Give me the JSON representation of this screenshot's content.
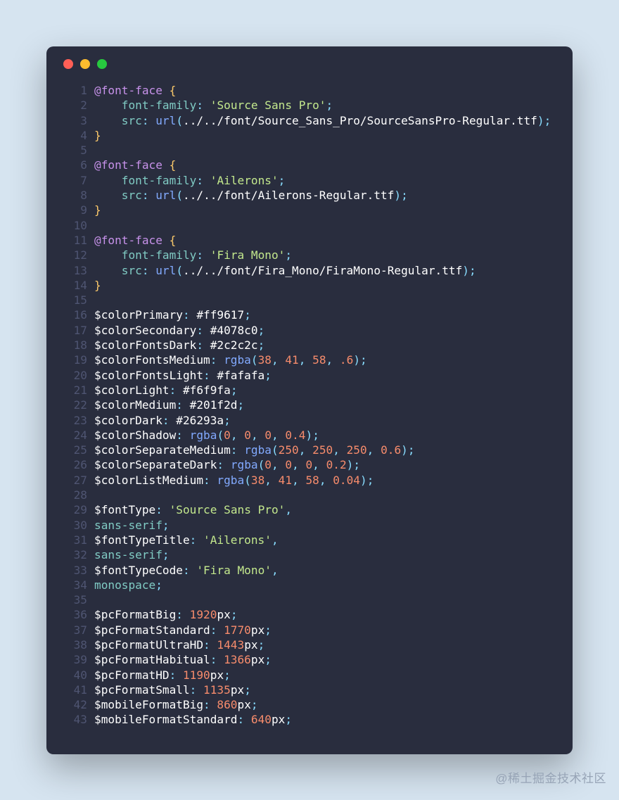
{
  "watermark": "@稀土掘金技术社区",
  "lines": [
    [
      {
        "t": "@font-face",
        "c": "tok-at"
      },
      {
        "t": " ",
        "c": ""
      },
      {
        "t": "{",
        "c": "tok-brace"
      }
    ],
    [
      {
        "t": "    ",
        "c": ""
      },
      {
        "t": "font-family",
        "c": "tok-prop"
      },
      {
        "t": ": ",
        "c": "tok-punc"
      },
      {
        "t": "'Source Sans Pro'",
        "c": "tok-str"
      },
      {
        "t": ";",
        "c": "tok-punc"
      }
    ],
    [
      {
        "t": "    ",
        "c": ""
      },
      {
        "t": "src",
        "c": "tok-prop"
      },
      {
        "t": ": ",
        "c": "tok-punc"
      },
      {
        "t": "url",
        "c": "tok-func"
      },
      {
        "t": "(",
        "c": "tok-punc"
      },
      {
        "t": "../../font/Source_Sans_Pro/SourceSansPro-Regular.ttf",
        "c": "tok-white"
      },
      {
        "t": ")",
        "c": "tok-punc"
      },
      {
        "t": ";",
        "c": "tok-punc"
      }
    ],
    [
      {
        "t": "}",
        "c": "tok-brace"
      }
    ],
    [
      {
        "t": "",
        "c": ""
      }
    ],
    [
      {
        "t": "@font-face",
        "c": "tok-at"
      },
      {
        "t": " ",
        "c": ""
      },
      {
        "t": "{",
        "c": "tok-brace"
      }
    ],
    [
      {
        "t": "    ",
        "c": ""
      },
      {
        "t": "font-family",
        "c": "tok-prop"
      },
      {
        "t": ": ",
        "c": "tok-punc"
      },
      {
        "t": "'Ailerons'",
        "c": "tok-str"
      },
      {
        "t": ";",
        "c": "tok-punc"
      }
    ],
    [
      {
        "t": "    ",
        "c": ""
      },
      {
        "t": "src",
        "c": "tok-prop"
      },
      {
        "t": ": ",
        "c": "tok-punc"
      },
      {
        "t": "url",
        "c": "tok-func"
      },
      {
        "t": "(",
        "c": "tok-punc"
      },
      {
        "t": "../../font/Ailerons-Regular.ttf",
        "c": "tok-white"
      },
      {
        "t": ")",
        "c": "tok-punc"
      },
      {
        "t": ";",
        "c": "tok-punc"
      }
    ],
    [
      {
        "t": "}",
        "c": "tok-brace"
      }
    ],
    [
      {
        "t": "",
        "c": ""
      }
    ],
    [
      {
        "t": "@font-face",
        "c": "tok-at"
      },
      {
        "t": " ",
        "c": ""
      },
      {
        "t": "{",
        "c": "tok-brace"
      }
    ],
    [
      {
        "t": "    ",
        "c": ""
      },
      {
        "t": "font-family",
        "c": "tok-prop"
      },
      {
        "t": ": ",
        "c": "tok-punc"
      },
      {
        "t": "'Fira Mono'",
        "c": "tok-str"
      },
      {
        "t": ";",
        "c": "tok-punc"
      }
    ],
    [
      {
        "t": "    ",
        "c": ""
      },
      {
        "t": "src",
        "c": "tok-prop"
      },
      {
        "t": ": ",
        "c": "tok-punc"
      },
      {
        "t": "url",
        "c": "tok-func"
      },
      {
        "t": "(",
        "c": "tok-punc"
      },
      {
        "t": "../../font/Fira_Mono/FiraMono-Regular.ttf",
        "c": "tok-white"
      },
      {
        "t": ")",
        "c": "tok-punc"
      },
      {
        "t": ";",
        "c": "tok-punc"
      }
    ],
    [
      {
        "t": "}",
        "c": "tok-brace"
      }
    ],
    [
      {
        "t": "",
        "c": ""
      }
    ],
    [
      {
        "t": "$colorPrimary",
        "c": "tok-white"
      },
      {
        "t": ": ",
        "c": "tok-punc"
      },
      {
        "t": "#ff9617",
        "c": "tok-white"
      },
      {
        "t": ";",
        "c": "tok-punc"
      }
    ],
    [
      {
        "t": "$colorSecondary",
        "c": "tok-white"
      },
      {
        "t": ": ",
        "c": "tok-punc"
      },
      {
        "t": "#4078c0",
        "c": "tok-white"
      },
      {
        "t": ";",
        "c": "tok-punc"
      }
    ],
    [
      {
        "t": "$colorFontsDark",
        "c": "tok-white"
      },
      {
        "t": ": ",
        "c": "tok-punc"
      },
      {
        "t": "#2c2c2c",
        "c": "tok-white"
      },
      {
        "t": ";",
        "c": "tok-punc"
      }
    ],
    [
      {
        "t": "$colorFontsMedium",
        "c": "tok-white"
      },
      {
        "t": ": ",
        "c": "tok-punc"
      },
      {
        "t": "rgba",
        "c": "tok-func"
      },
      {
        "t": "(",
        "c": "tok-punc"
      },
      {
        "t": "38",
        "c": "tok-num"
      },
      {
        "t": ", ",
        "c": "tok-punc"
      },
      {
        "t": "41",
        "c": "tok-num"
      },
      {
        "t": ", ",
        "c": "tok-punc"
      },
      {
        "t": "58",
        "c": "tok-num"
      },
      {
        "t": ", ",
        "c": "tok-punc"
      },
      {
        "t": ".6",
        "c": "tok-num"
      },
      {
        "t": ")",
        "c": "tok-punc"
      },
      {
        "t": ";",
        "c": "tok-punc"
      }
    ],
    [
      {
        "t": "$colorFontsLight",
        "c": "tok-white"
      },
      {
        "t": ": ",
        "c": "tok-punc"
      },
      {
        "t": "#fafafa",
        "c": "tok-white"
      },
      {
        "t": ";",
        "c": "tok-punc"
      }
    ],
    [
      {
        "t": "$colorLight",
        "c": "tok-white"
      },
      {
        "t": ": ",
        "c": "tok-punc"
      },
      {
        "t": "#f6f9fa",
        "c": "tok-white"
      },
      {
        "t": ";",
        "c": "tok-punc"
      }
    ],
    [
      {
        "t": "$colorMedium",
        "c": "tok-white"
      },
      {
        "t": ": ",
        "c": "tok-punc"
      },
      {
        "t": "#201f2d",
        "c": "tok-white"
      },
      {
        "t": ";",
        "c": "tok-punc"
      }
    ],
    [
      {
        "t": "$colorDark",
        "c": "tok-white"
      },
      {
        "t": ": ",
        "c": "tok-punc"
      },
      {
        "t": "#26293a",
        "c": "tok-white"
      },
      {
        "t": ";",
        "c": "tok-punc"
      }
    ],
    [
      {
        "t": "$colorShadow",
        "c": "tok-white"
      },
      {
        "t": ": ",
        "c": "tok-punc"
      },
      {
        "t": "rgba",
        "c": "tok-func"
      },
      {
        "t": "(",
        "c": "tok-punc"
      },
      {
        "t": "0",
        "c": "tok-num"
      },
      {
        "t": ", ",
        "c": "tok-punc"
      },
      {
        "t": "0",
        "c": "tok-num"
      },
      {
        "t": ", ",
        "c": "tok-punc"
      },
      {
        "t": "0",
        "c": "tok-num"
      },
      {
        "t": ", ",
        "c": "tok-punc"
      },
      {
        "t": "0.4",
        "c": "tok-num"
      },
      {
        "t": ")",
        "c": "tok-punc"
      },
      {
        "t": ";",
        "c": "tok-punc"
      }
    ],
    [
      {
        "t": "$colorSeparateMedium",
        "c": "tok-white"
      },
      {
        "t": ": ",
        "c": "tok-punc"
      },
      {
        "t": "rgba",
        "c": "tok-func"
      },
      {
        "t": "(",
        "c": "tok-punc"
      },
      {
        "t": "250",
        "c": "tok-num"
      },
      {
        "t": ", ",
        "c": "tok-punc"
      },
      {
        "t": "250",
        "c": "tok-num"
      },
      {
        "t": ", ",
        "c": "tok-punc"
      },
      {
        "t": "250",
        "c": "tok-num"
      },
      {
        "t": ", ",
        "c": "tok-punc"
      },
      {
        "t": "0.6",
        "c": "tok-num"
      },
      {
        "t": ")",
        "c": "tok-punc"
      },
      {
        "t": ";",
        "c": "tok-punc"
      }
    ],
    [
      {
        "t": "$colorSeparateDark",
        "c": "tok-white"
      },
      {
        "t": ": ",
        "c": "tok-punc"
      },
      {
        "t": "rgba",
        "c": "tok-func"
      },
      {
        "t": "(",
        "c": "tok-punc"
      },
      {
        "t": "0",
        "c": "tok-num"
      },
      {
        "t": ", ",
        "c": "tok-punc"
      },
      {
        "t": "0",
        "c": "tok-num"
      },
      {
        "t": ", ",
        "c": "tok-punc"
      },
      {
        "t": "0",
        "c": "tok-num"
      },
      {
        "t": ", ",
        "c": "tok-punc"
      },
      {
        "t": "0.2",
        "c": "tok-num"
      },
      {
        "t": ")",
        "c": "tok-punc"
      },
      {
        "t": ";",
        "c": "tok-punc"
      }
    ],
    [
      {
        "t": "$colorListMedium",
        "c": "tok-white"
      },
      {
        "t": ": ",
        "c": "tok-punc"
      },
      {
        "t": "rgba",
        "c": "tok-func"
      },
      {
        "t": "(",
        "c": "tok-punc"
      },
      {
        "t": "38",
        "c": "tok-num"
      },
      {
        "t": ", ",
        "c": "tok-punc"
      },
      {
        "t": "41",
        "c": "tok-num"
      },
      {
        "t": ", ",
        "c": "tok-punc"
      },
      {
        "t": "58",
        "c": "tok-num"
      },
      {
        "t": ", ",
        "c": "tok-punc"
      },
      {
        "t": "0.04",
        "c": "tok-num"
      },
      {
        "t": ")",
        "c": "tok-punc"
      },
      {
        "t": ";",
        "c": "tok-punc"
      }
    ],
    [
      {
        "t": "",
        "c": ""
      }
    ],
    [
      {
        "t": "$fontType",
        "c": "tok-white"
      },
      {
        "t": ": ",
        "c": "tok-punc"
      },
      {
        "t": "'Source Sans Pro'",
        "c": "tok-str"
      },
      {
        "t": ",",
        "c": "tok-punc"
      }
    ],
    [
      {
        "t": "sans-serif",
        "c": "tok-prop"
      },
      {
        "t": ";",
        "c": "tok-punc"
      }
    ],
    [
      {
        "t": "$fontTypeTitle",
        "c": "tok-white"
      },
      {
        "t": ": ",
        "c": "tok-punc"
      },
      {
        "t": "'Ailerons'",
        "c": "tok-str"
      },
      {
        "t": ",",
        "c": "tok-punc"
      }
    ],
    [
      {
        "t": "sans-serif",
        "c": "tok-prop"
      },
      {
        "t": ";",
        "c": "tok-punc"
      }
    ],
    [
      {
        "t": "$fontTypeCode",
        "c": "tok-white"
      },
      {
        "t": ": ",
        "c": "tok-punc"
      },
      {
        "t": "'Fira Mono'",
        "c": "tok-str"
      },
      {
        "t": ",",
        "c": "tok-punc"
      }
    ],
    [
      {
        "t": "monospace",
        "c": "tok-prop"
      },
      {
        "t": ";",
        "c": "tok-punc"
      }
    ],
    [
      {
        "t": "",
        "c": ""
      }
    ],
    [
      {
        "t": "$pcFormatBig",
        "c": "tok-white"
      },
      {
        "t": ": ",
        "c": "tok-punc"
      },
      {
        "t": "1920",
        "c": "tok-num"
      },
      {
        "t": "px",
        "c": "tok-white"
      },
      {
        "t": ";",
        "c": "tok-punc"
      }
    ],
    [
      {
        "t": "$pcFormatStandard",
        "c": "tok-white"
      },
      {
        "t": ": ",
        "c": "tok-punc"
      },
      {
        "t": "1770",
        "c": "tok-num"
      },
      {
        "t": "px",
        "c": "tok-white"
      },
      {
        "t": ";",
        "c": "tok-punc"
      }
    ],
    [
      {
        "t": "$pcFormatUltraHD",
        "c": "tok-white"
      },
      {
        "t": ": ",
        "c": "tok-punc"
      },
      {
        "t": "1443",
        "c": "tok-num"
      },
      {
        "t": "px",
        "c": "tok-white"
      },
      {
        "t": ";",
        "c": "tok-punc"
      }
    ],
    [
      {
        "t": "$pcFormatHabitual",
        "c": "tok-white"
      },
      {
        "t": ": ",
        "c": "tok-punc"
      },
      {
        "t": "1366",
        "c": "tok-num"
      },
      {
        "t": "px",
        "c": "tok-white"
      },
      {
        "t": ";",
        "c": "tok-punc"
      }
    ],
    [
      {
        "t": "$pcFormatHD",
        "c": "tok-white"
      },
      {
        "t": ": ",
        "c": "tok-punc"
      },
      {
        "t": "1190",
        "c": "tok-num"
      },
      {
        "t": "px",
        "c": "tok-white"
      },
      {
        "t": ";",
        "c": "tok-punc"
      }
    ],
    [
      {
        "t": "$pcFormatSmall",
        "c": "tok-white"
      },
      {
        "t": ": ",
        "c": "tok-punc"
      },
      {
        "t": "1135",
        "c": "tok-num"
      },
      {
        "t": "px",
        "c": "tok-white"
      },
      {
        "t": ";",
        "c": "tok-punc"
      }
    ],
    [
      {
        "t": "$mobileFormatBig",
        "c": "tok-white"
      },
      {
        "t": ": ",
        "c": "tok-punc"
      },
      {
        "t": "860",
        "c": "tok-num"
      },
      {
        "t": "px",
        "c": "tok-white"
      },
      {
        "t": ";",
        "c": "tok-punc"
      }
    ],
    [
      {
        "t": "$mobileFormatStandard",
        "c": "tok-white"
      },
      {
        "t": ": ",
        "c": "tok-punc"
      },
      {
        "t": "640",
        "c": "tok-num"
      },
      {
        "t": "px",
        "c": "tok-white"
      },
      {
        "t": ";",
        "c": "tok-punc"
      }
    ]
  ]
}
